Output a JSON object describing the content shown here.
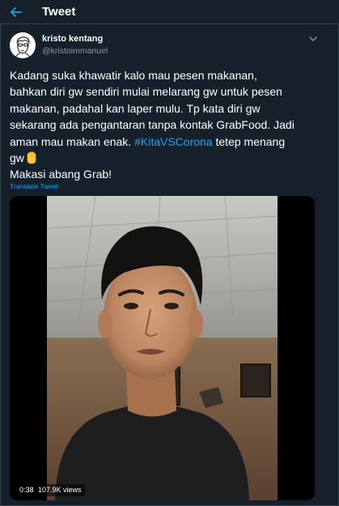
{
  "header": {
    "title": "Tweet",
    "back_icon": "arrow-left-icon"
  },
  "author": {
    "display_name": "kristo kentang",
    "handle": "@kristoimmanuel",
    "avatar_icon": "cartoon-face-avatar",
    "more_icon": "chevron-down-icon"
  },
  "tweet": {
    "lines": [
      "Kadang suka khawatir kalo mau pesen makanan,",
      "bahkan diri gw sendiri mulai melarang gw untuk pesen",
      "makanan, padahal kan laper mulu. Tp kata diri gw",
      "sekarang ada pengantaran tanpa kontak GrabFood. Jadi"
    ],
    "line5_before": "aman mau makan enak. ",
    "hashtag": "#KitaVSCorona",
    "line5_after": " tetep menang",
    "line6": "gw",
    "emoji": "raised-fist-emoji",
    "line7": "Makasi abang Grab!"
  },
  "translate_label": "Translate Tweet",
  "video": {
    "duration": "0:38",
    "views": "107.9K views"
  },
  "colors": {
    "background": "#15202b",
    "border": "#38444d",
    "accent": "#1da1f2",
    "secondary_text": "#8899a6"
  }
}
